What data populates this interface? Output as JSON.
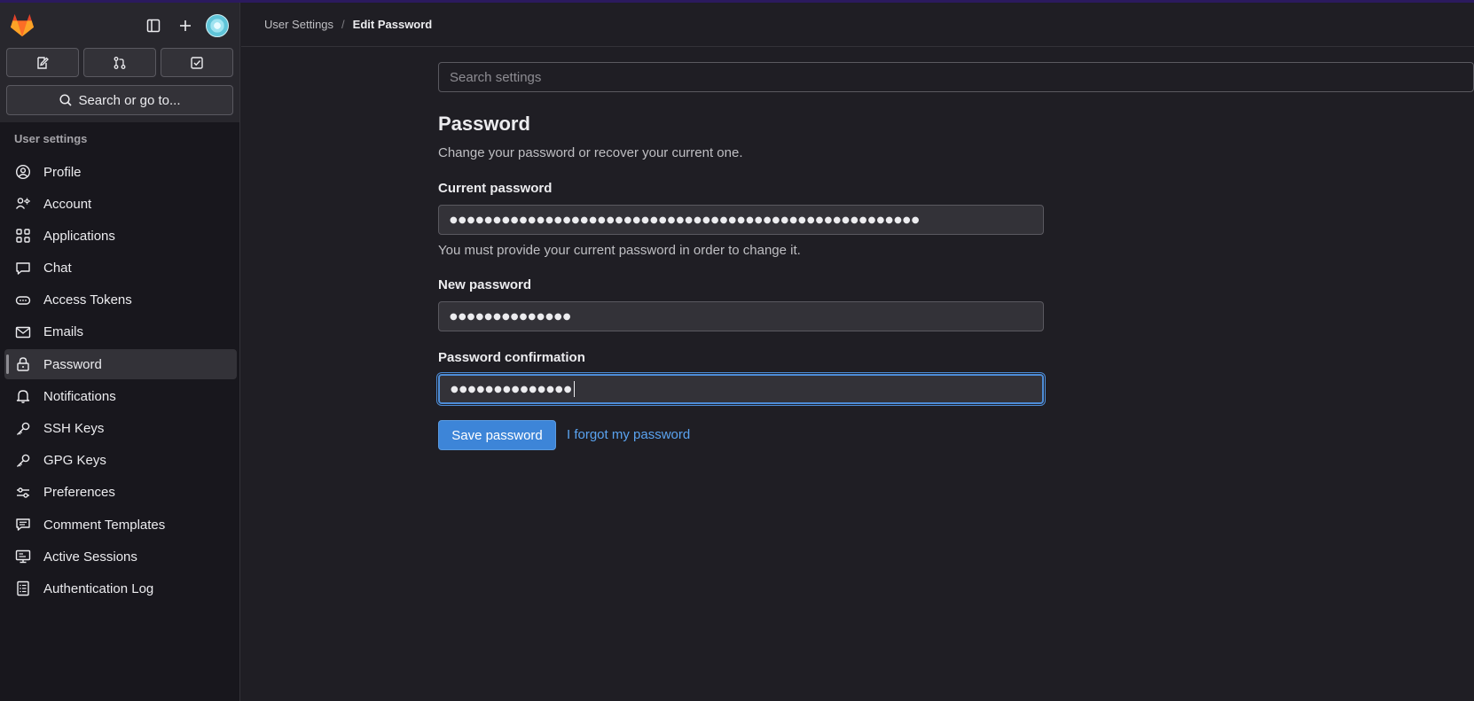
{
  "sidebar": {
    "section_title": "User settings",
    "search_label": "Search or go to...",
    "items": [
      {
        "label": "Profile",
        "icon": "profile-icon"
      },
      {
        "label": "Account",
        "icon": "account-icon"
      },
      {
        "label": "Applications",
        "icon": "applications-icon"
      },
      {
        "label": "Chat",
        "icon": "chat-icon"
      },
      {
        "label": "Access Tokens",
        "icon": "token-icon"
      },
      {
        "label": "Emails",
        "icon": "mail-icon"
      },
      {
        "label": "Password",
        "icon": "lock-icon",
        "active": true
      },
      {
        "label": "Notifications",
        "icon": "bell-icon"
      },
      {
        "label": "SSH Keys",
        "icon": "key-icon"
      },
      {
        "label": "GPG Keys",
        "icon": "key-icon"
      },
      {
        "label": "Preferences",
        "icon": "preferences-icon"
      },
      {
        "label": "Comment Templates",
        "icon": "comment-icon"
      },
      {
        "label": "Active Sessions",
        "icon": "monitor-icon"
      },
      {
        "label": "Authentication Log",
        "icon": "log-icon"
      }
    ]
  },
  "breadcrumb": {
    "parent": "User Settings",
    "separator": "/",
    "current": "Edit Password"
  },
  "main": {
    "search_placeholder": "Search settings",
    "title": "Password",
    "description": "Change your password or recover your current one.",
    "current_password": {
      "label": "Current password",
      "value": "●●●●●●●●●●●●●●●●●●●●●●●●●●●●●●●●●●●●●●●●●●●●●●●●●●●●●●",
      "help": "You must provide your current password in order to change it."
    },
    "new_password": {
      "label": "New password",
      "value": "●●●●●●●●●●●●●●"
    },
    "password_confirmation": {
      "label": "Password confirmation",
      "value": "●●●●●●●●●●●●●●"
    },
    "save_label": "Save password",
    "forgot_label": "I forgot my password"
  },
  "colors": {
    "accent": "#3d85d8",
    "link": "#5aa3f0",
    "background": "#1f1e24",
    "sidebar": "#18171d"
  }
}
